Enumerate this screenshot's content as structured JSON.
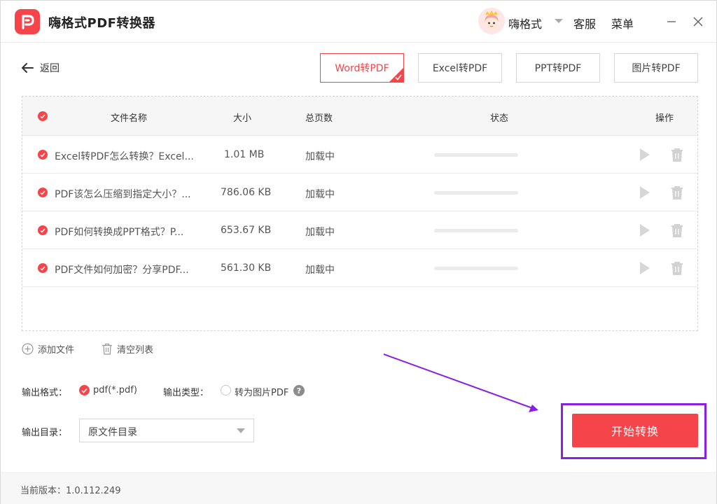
{
  "app": {
    "title": "嗨格式PDF转换器",
    "username": "嗨格式",
    "service": "客服",
    "menu": "菜单"
  },
  "nav": {
    "back": "返回",
    "tabs": [
      {
        "label": "Word转PDF",
        "active": true
      },
      {
        "label": "Excel转PDF",
        "active": false
      },
      {
        "label": "PPT转PDF",
        "active": false
      },
      {
        "label": "图片转PDF",
        "active": false
      }
    ]
  },
  "table": {
    "headers": {
      "name": "文件名称",
      "size": "大小",
      "pages": "总页数",
      "status": "状态",
      "action": "操作"
    },
    "rows": [
      {
        "name": "Excel转PDF怎么转换？Excel...",
        "size": "1.01 MB",
        "pages": "加载中"
      },
      {
        "name": "PDF该怎么压缩到指定大小？...",
        "size": "786.06 KB",
        "pages": "加载中"
      },
      {
        "name": "PDF如何转换成PPT格式？P...",
        "size": "653.67 KB",
        "pages": "加载中"
      },
      {
        "name": "PDF文件如何加密？分享PDF...",
        "size": "561.30 KB",
        "pages": "加载中"
      }
    ]
  },
  "actions": {
    "add_file": "添加文件",
    "clear_list": "清空列表"
  },
  "output": {
    "format_label": "输出格式：",
    "format_value": "pdf(*.pdf)",
    "type_label": "输出类型：",
    "type_option": "转为图片PDF",
    "help": "?",
    "dir_label": "输出目录：",
    "dir_value": "原文件目录"
  },
  "start_button": "开始转换",
  "footer": {
    "version": "当前版本：1.0.112.249"
  },
  "colors": {
    "accent": "#f5454b",
    "highlight": "#8a20e0"
  }
}
